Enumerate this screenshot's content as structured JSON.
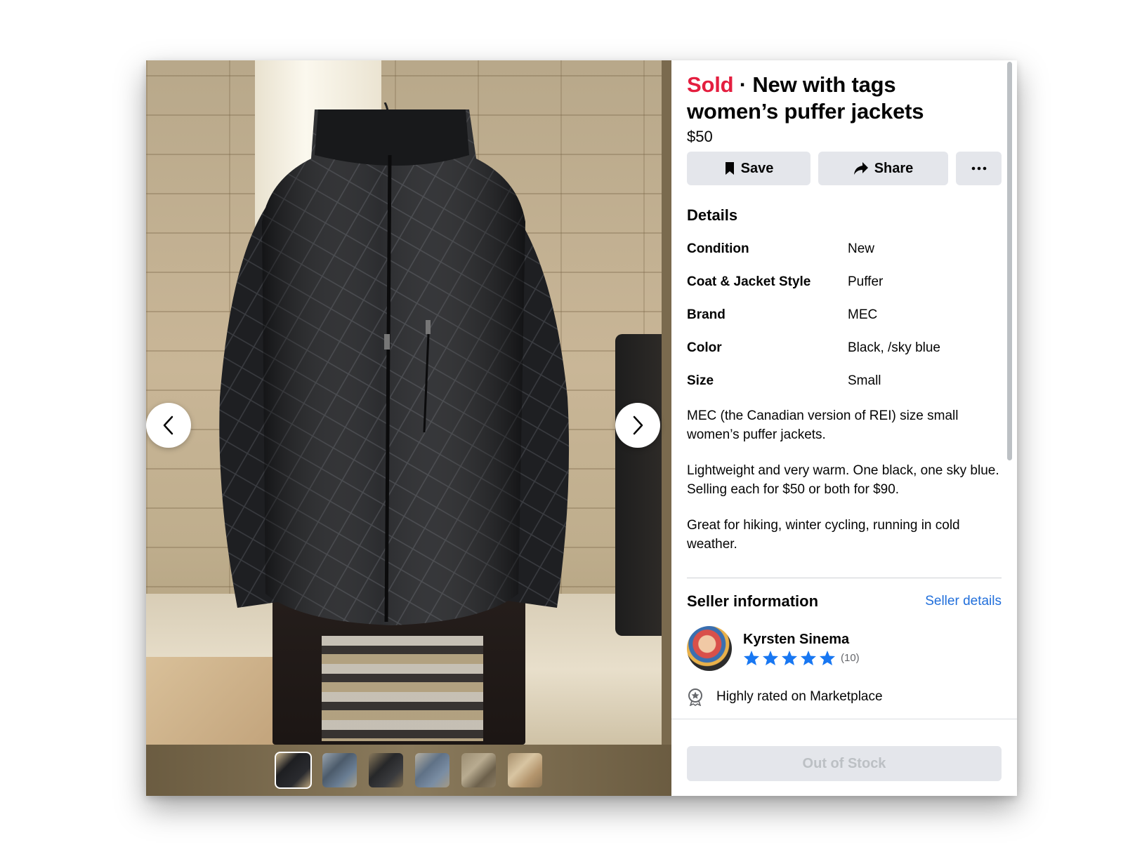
{
  "listing": {
    "status": "Sold",
    "separator": "·",
    "title_part1": "New with tags",
    "title_part2": "women’s puffer jackets",
    "price": "$50",
    "status_color": "#e41e3f"
  },
  "actions": {
    "save_label": "Save",
    "share_label": "Share",
    "more_label": "···"
  },
  "details": {
    "heading": "Details",
    "rows": [
      {
        "label": "Condition",
        "value": "New"
      },
      {
        "label": "Coat & Jacket Style",
        "value": "Puffer"
      },
      {
        "label": "Brand",
        "value": "MEC"
      },
      {
        "label": "Color",
        "value": "Black, /sky blue"
      },
      {
        "label": "Size",
        "value": "Small"
      }
    ],
    "description": [
      "MEC (the Canadian version of REI) size small women’s puffer jackets.",
      "Lightweight and very warm. One black, one sky blue. Selling each for $50 or both for $90.",
      "Great for hiking, winter cycling, running in cold weather."
    ]
  },
  "seller": {
    "heading": "Seller information",
    "details_link": "Seller details",
    "name": "Kyrsten Sinema",
    "rating_stars": 5,
    "rating_count": "(10)",
    "badge": "Highly rated on Marketplace",
    "link_color": "#216fdb",
    "star_color": "#1877f2"
  },
  "viewer": {
    "thumbnail_count": 6,
    "active_thumbnail": 1
  },
  "footer": {
    "button_label": "Out of Stock"
  }
}
